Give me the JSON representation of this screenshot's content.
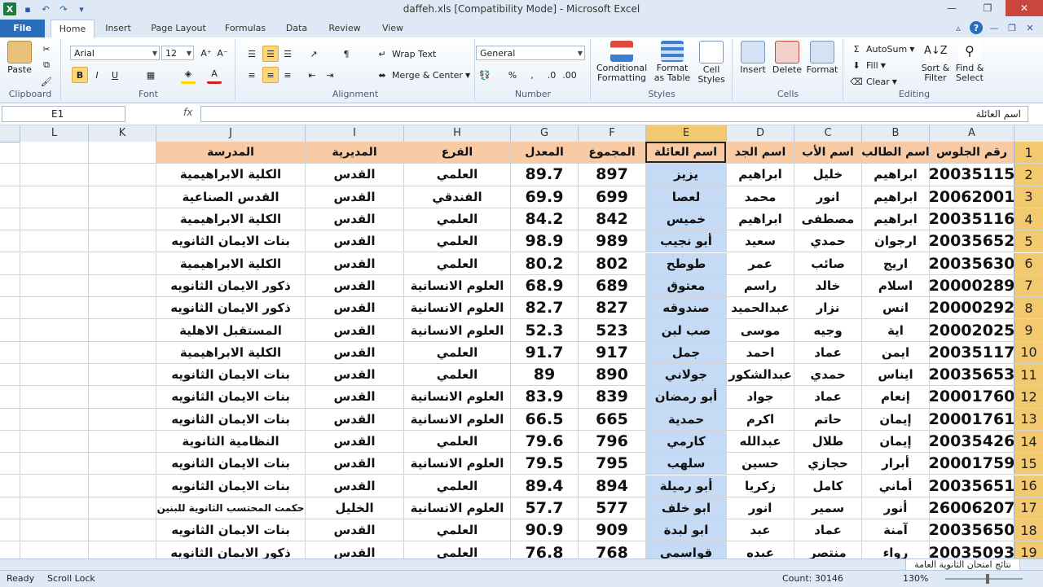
{
  "window": {
    "title": "daffeh.xls  [Compatibility Mode]  -  Microsoft Excel"
  },
  "tabs": {
    "file": "File",
    "home": "Home",
    "insert": "Insert",
    "page_layout": "Page Layout",
    "formulas": "Formulas",
    "data": "Data",
    "review": "Review",
    "view": "View"
  },
  "ribbon": {
    "paste": "Paste",
    "clipboard": "Clipboard",
    "font_name": "Arial",
    "font_size": "12",
    "font": "Font",
    "wrap_text": "Wrap Text",
    "merge_center": "Merge & Center",
    "alignment": "Alignment",
    "number_format": "General",
    "number": "Number",
    "conditional_formatting_1": "Conditional",
    "conditional_formatting_2": "Formatting",
    "format_as_table_1": "Format",
    "format_as_table_2": "as Table",
    "cell_styles_1": "Cell",
    "cell_styles_2": "Styles",
    "styles": "Styles",
    "insert": "Insert",
    "delete": "Delete",
    "format": "Format",
    "cells": "Cells",
    "autosum": "AutoSum",
    "fill": "Fill",
    "clear": "Clear",
    "sort_filter_1": "Sort &",
    "sort_filter_2": "Filter",
    "find_select_1": "Find &",
    "find_select_2": "Select",
    "editing": "Editing"
  },
  "formula_bar": {
    "name_box": "E1",
    "fx": "fx",
    "formula": "اسم العائلة"
  },
  "columns": {
    "L": "L",
    "K": "K",
    "J": "J",
    "I": "I",
    "H": "H",
    "G": "G",
    "F": "F",
    "E": "E",
    "D": "D",
    "C": "C",
    "B": "B",
    "A": "A"
  },
  "headers": {
    "A": "رقم الجلوس",
    "B": "اسم الطالب",
    "C": "اسم الأب",
    "D": "اسم الجد",
    "E": "اسم العائلة",
    "F": "المجموع",
    "G": "المعدل",
    "H": "الفرع",
    "I": "المديرية",
    "J": "المدرسة"
  },
  "rows": [
    {
      "n": "2",
      "A": "20035115",
      "B": "ابراهيم",
      "C": "خليل",
      "D": "ابراهيم",
      "E": "يزيز",
      "F": "897",
      "G": "89.7",
      "H": "العلمي",
      "I": "القدس",
      "J": "الكلية الابراهيمية"
    },
    {
      "n": "3",
      "A": "20062001",
      "B": "ابراهيم",
      "C": "انور",
      "D": "محمد",
      "E": "لعصا",
      "F": "699",
      "G": "69.9",
      "H": "الفندقي",
      "I": "القدس",
      "J": "القدس الصناعية"
    },
    {
      "n": "4",
      "A": "20035116",
      "B": "ابراهيم",
      "C": "مصطفى",
      "D": "ابراهيم",
      "E": "خميس",
      "F": "842",
      "G": "84.2",
      "H": "العلمي",
      "I": "القدس",
      "J": "الكلية الابراهيمية"
    },
    {
      "n": "5",
      "A": "20035652",
      "B": "ارجوان",
      "C": "حمدي",
      "D": "سعيد",
      "E": "أبو نجيب",
      "F": "989",
      "G": "98.9",
      "H": "العلمي",
      "I": "القدس",
      "J": "بنات الايمان الثانويه"
    },
    {
      "n": "6",
      "A": "20035630",
      "B": "اريج",
      "C": "صائب",
      "D": "عمر",
      "E": "طوطح",
      "F": "802",
      "G": "80.2",
      "H": "العلمي",
      "I": "القدس",
      "J": "الكلية الابراهيمية"
    },
    {
      "n": "7",
      "A": "20000289",
      "B": "اسلام",
      "C": "خالد",
      "D": "راسم",
      "E": "معتوق",
      "F": "689",
      "G": "68.9",
      "H": "العلوم الانسانية",
      "I": "القدس",
      "J": "ذكور الايمان الثانويه"
    },
    {
      "n": "8",
      "A": "20000292",
      "B": "انس",
      "C": "نزار",
      "D": "عبدالحميد",
      "E": "صندوقه",
      "F": "827",
      "G": "82.7",
      "H": "العلوم الانسانية",
      "I": "القدس",
      "J": "ذكور الايمان الثانويه"
    },
    {
      "n": "9",
      "A": "20002025",
      "B": "اية",
      "C": "وجيه",
      "D": "موسى",
      "E": "صب لبن",
      "F": "523",
      "G": "52.3",
      "H": "العلوم الانسانية",
      "I": "القدس",
      "J": "المستقبل الاهلية"
    },
    {
      "n": "10",
      "A": "20035117",
      "B": "ايمن",
      "C": "عماد",
      "D": "احمد",
      "E": "جمل",
      "F": "917",
      "G": "91.7",
      "H": "العلمي",
      "I": "القدس",
      "J": "الكلية الابراهيمية"
    },
    {
      "n": "11",
      "A": "20035653",
      "B": "ايناس",
      "C": "حمدي",
      "D": "عبدالشكور",
      "E": "جولاني",
      "F": "890",
      "G": "89",
      "H": "العلمي",
      "I": "القدس",
      "J": "بنات الايمان الثانويه"
    },
    {
      "n": "12",
      "A": "20001760",
      "B": "إنعام",
      "C": "عماد",
      "D": "جواد",
      "E": "أبو رمضان",
      "F": "839",
      "G": "83.9",
      "H": "العلوم الانسانية",
      "I": "القدس",
      "J": "بنات الايمان الثانويه"
    },
    {
      "n": "13",
      "A": "20001761",
      "B": "إيمان",
      "C": "حاتم",
      "D": "اكرم",
      "E": "حمدية",
      "F": "665",
      "G": "66.5",
      "H": "العلوم الانسانية",
      "I": "القدس",
      "J": "بنات الايمان الثانويه"
    },
    {
      "n": "14",
      "A": "20035426",
      "B": "إيمان",
      "C": "طلال",
      "D": "عبدالله",
      "E": "كارمي",
      "F": "796",
      "G": "79.6",
      "H": "العلمي",
      "I": "القدس",
      "J": "النظامية الثانوية"
    },
    {
      "n": "15",
      "A": "20001759",
      "B": "أبرار",
      "C": "حجازي",
      "D": "حسين",
      "E": "سلهب",
      "F": "795",
      "G": "79.5",
      "H": "العلوم الانسانية",
      "I": "القدس",
      "J": "بنات الايمان الثانويه"
    },
    {
      "n": "16",
      "A": "20035651",
      "B": "أماني",
      "C": "كامل",
      "D": "زكريا",
      "E": "أبو رميلة",
      "F": "894",
      "G": "89.4",
      "H": "العلمي",
      "I": "القدس",
      "J": "بنات الايمان الثانويه"
    },
    {
      "n": "17",
      "A": "26006207",
      "B": "أنور",
      "C": "سمير",
      "D": "انور",
      "E": "ابو خلف",
      "F": "577",
      "G": "57.7",
      "H": "العلوم الانسانية",
      "I": "الخليل",
      "J": "حكمت المحتسب الثانوية للبنين"
    },
    {
      "n": "18",
      "A": "20035650",
      "B": "آمنة",
      "C": "عماد",
      "D": "عبد",
      "E": "ابو لبدة",
      "F": "909",
      "G": "90.9",
      "H": "العلمي",
      "I": "القدس",
      "J": "بنات الايمان الثانويه"
    },
    {
      "n": "19",
      "A": "20035093",
      "B": "رواء",
      "C": "منتصر",
      "D": "عبده",
      "E": "قواسمي",
      "F": "768",
      "G": "76.8",
      "H": "العلمي",
      "I": "القدس",
      "J": "ذكور الايمان الثانويه"
    }
  ],
  "sheet": {
    "tab": "نتائج امتحان الثانوية العامة"
  },
  "status": {
    "ready": "Ready",
    "scroll_lock": "Scroll Lock",
    "count": "Count: 30146",
    "zoom": "130%"
  }
}
